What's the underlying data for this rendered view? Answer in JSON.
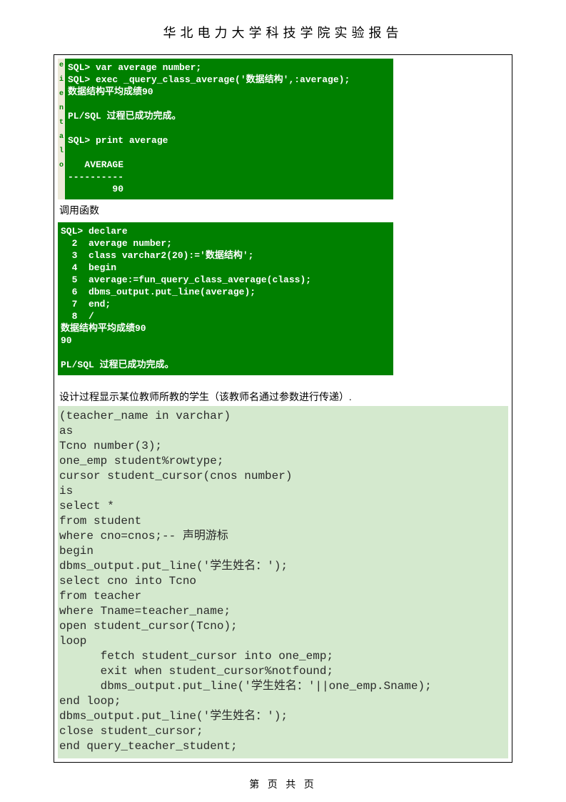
{
  "title": "华北电力大学科技学院实验报告",
  "term1": "SQL> var average number;\nSQL> exec _query_class_average('数据结构',:average);\n数据结构平均成绩90\n\nPL/SQL 过程已成功完成。\n\nSQL> print average\n\n   AVERAGE\n----------\n        90",
  "gutter": "e\ni\n\ne\nn\nt\n\na\n\nl\no",
  "mid_label": "调用函数",
  "term2": "SQL> declare\n  2  average number;\n  3  class varchar2(20):='数据结构';\n  4  begin\n  5  average:=fun_query_class_average(class);\n  6  dbms_output.put_line(average);\n  7  end;\n  8  /\n数据结构平均成绩90\n90\n\nPL/SQL 过程已成功完成。",
  "desc_label": "设计过程显示某位教师所教的学生（该教师名通过参数进行传递）.",
  "code": "(teacher_name in varchar)\nas\nTcno number(3);\none_emp student%rowtype;\ncursor student_cursor(cnos number)\nis\nselect *\nfrom student\nwhere cno=cnos;-- 声明游标\nbegin\ndbms_output.put_line('学生姓名：');\nselect cno into Tcno\nfrom teacher\nwhere Tname=teacher_name;\nopen student_cursor(Tcno);\nloop\n      fetch student_cursor into one_emp;\n      exit when student_cursor%notfound;\n      dbms_output.put_line('学生姓名：'||one_emp.Sname);\nend loop;\ndbms_output.put_line('学生姓名：');\nclose student_cursor;\nend query_teacher_student;",
  "footer": "第  页 共  页"
}
